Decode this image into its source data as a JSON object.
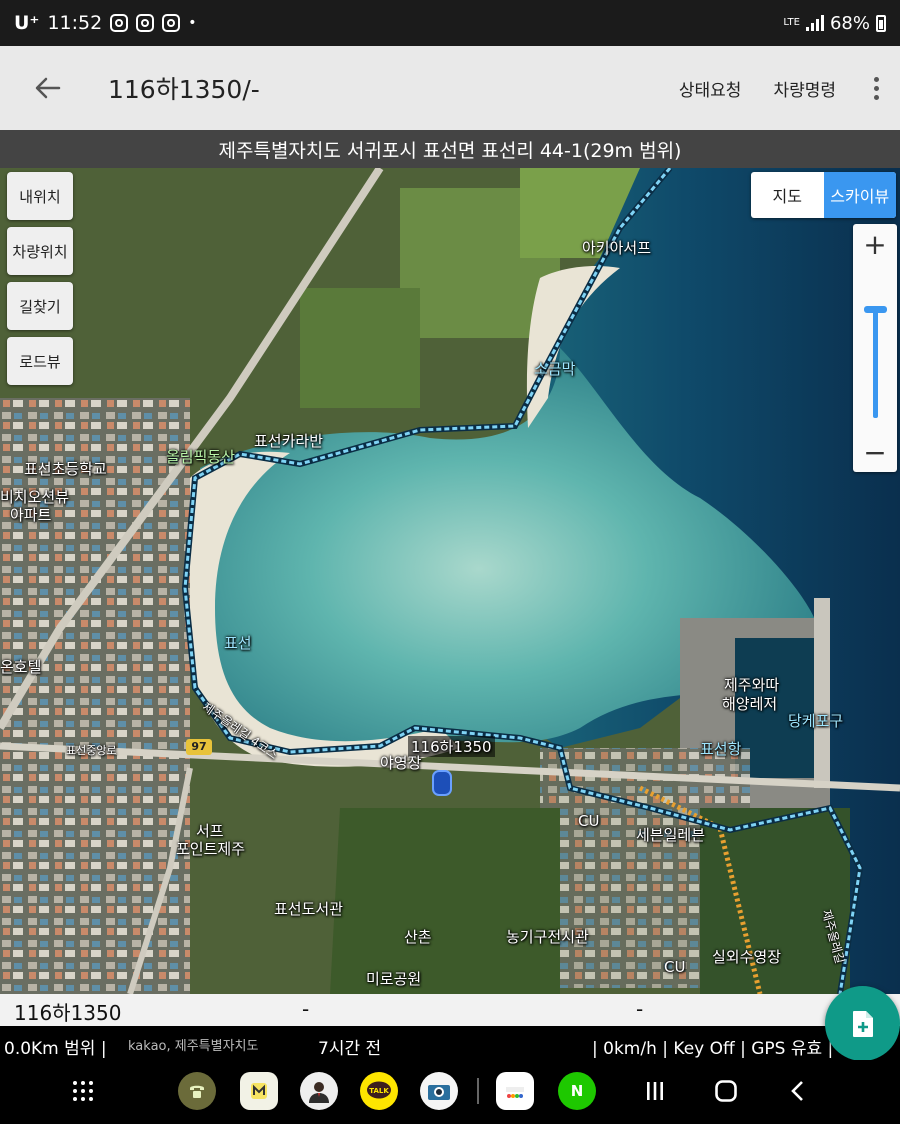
{
  "status_bar": {
    "carrier": "U⁺",
    "time": "11:52",
    "notification_icons": [
      "instagram-icon",
      "instagram-icon",
      "instagram-icon"
    ],
    "dot": "•",
    "network": "LTE",
    "battery": "68%"
  },
  "header": {
    "back_icon": "arrow-left-icon",
    "title": "116하1350/-",
    "status_request": "상태요청",
    "vehicle_command": "차량명령",
    "more_icon": "kebab-menu-icon"
  },
  "address": "제주특별자치도 서귀포시 표선면 표선리 44-1(29m 범위)",
  "map": {
    "left_buttons": [
      "내위치",
      "차량위치",
      "길찾기",
      "로드뷰"
    ],
    "view_toggle": {
      "map": "지도",
      "skyview": "스카이뷰",
      "active": "스카이뷰"
    },
    "zoom": {
      "plus": "+",
      "minus": "−",
      "level": 0.1
    },
    "labels": {
      "aki": "아키아서프",
      "sogeummak": "소금막",
      "pyoseon_karaban": "표선카라반",
      "olympic_park": "올림픽동산",
      "school": "표선초등학교",
      "apartment_1": "비치오션뷰",
      "apartment_2": "아파트",
      "hotel": "온호텔",
      "pyoseon_beach": "표선",
      "course": "제주올레길 4코스",
      "road_name": "표선중앙로",
      "route_number": "97",
      "vehicle_label": "116하1350",
      "campsite": "야영장",
      "jejuwa_1": "제주와따",
      "jejuwa_2": "해양레저",
      "dangke": "당케포구",
      "pyoseon_port": "표선항",
      "cu_1": "CU",
      "sebeun": "세븐일레븐",
      "seopo_1": "서프",
      "seopo_2": "포인트제주",
      "library": "표선도서관",
      "sanchon": "산촌",
      "farm_museum": "농기구전시관",
      "miro_park": "미로공원",
      "cu_2": "CU",
      "outdoor_pool": "실외수영장",
      "olle_right": "제주올레길",
      "watermark": "kakao, 제주특별자치도"
    },
    "colors": {
      "route": "#7fd3f5",
      "orange_road": "#f5a623",
      "water": "#0d3a5c"
    }
  },
  "info_bar": {
    "plate": "116하1350",
    "field_2": "-",
    "field_3": "-"
  },
  "status_line": {
    "range": "0.0Km 범위 |",
    "time_ago": "7시간 전",
    "engine": "| 0km/h | Key Off | GPS 유효 |"
  },
  "fab_icon": "add-document-icon",
  "nav_bar": {
    "apps_icon": "app-drawer-icon",
    "dock_apps": [
      "phone-app-icon",
      "memo-app-icon",
      "contacts-app-icon",
      "kakaotalk-icon",
      "camera-app-icon",
      "agoda-app-icon",
      "naver-app-icon"
    ],
    "recents_icon": "recents-icon",
    "home_icon": "home-icon",
    "back_icon": "nav-back-icon",
    "kakaotalk_label": "TALK",
    "naver_label": "N"
  }
}
